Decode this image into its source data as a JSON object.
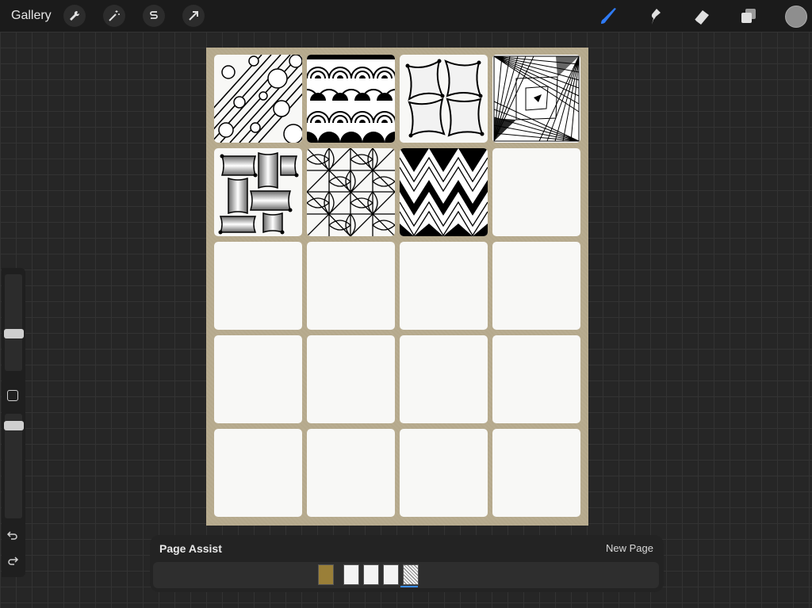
{
  "toolbar": {
    "gallery_label": "Gallery",
    "left_tools": [
      "wrench-icon",
      "magic-wand-icon",
      "selection-s-icon",
      "transform-arrow-icon"
    ],
    "right_tools": [
      "brush-icon",
      "smudge-icon",
      "eraser-icon",
      "layers-icon"
    ],
    "active_tool": "brush-icon",
    "accent": "#2f7bf5",
    "current_color": "#8e8e8e"
  },
  "sidebar": {
    "brush_size_level": 0.55,
    "opacity_level": 0.55,
    "items": [
      "modify-square-icon",
      "undo-icon",
      "redo-icon"
    ]
  },
  "canvas": {
    "background": "#b5a98c",
    "tiles": [
      "circles-stripes",
      "scallop-arches",
      "square-pillows",
      "spiral-triangles",
      "weave",
      "petal-grid",
      "zigzag-diamonds",
      "blank",
      "blank",
      "blank",
      "blank",
      "blank",
      "blank",
      "blank",
      "blank",
      "blank",
      "blank",
      "blank",
      "blank",
      "blank"
    ]
  },
  "page_assist": {
    "title": "Page Assist",
    "new_page_label": "New Page",
    "pages": [
      "gold",
      "blank",
      "blank",
      "blank",
      "patterned"
    ],
    "selected_page": 4
  }
}
